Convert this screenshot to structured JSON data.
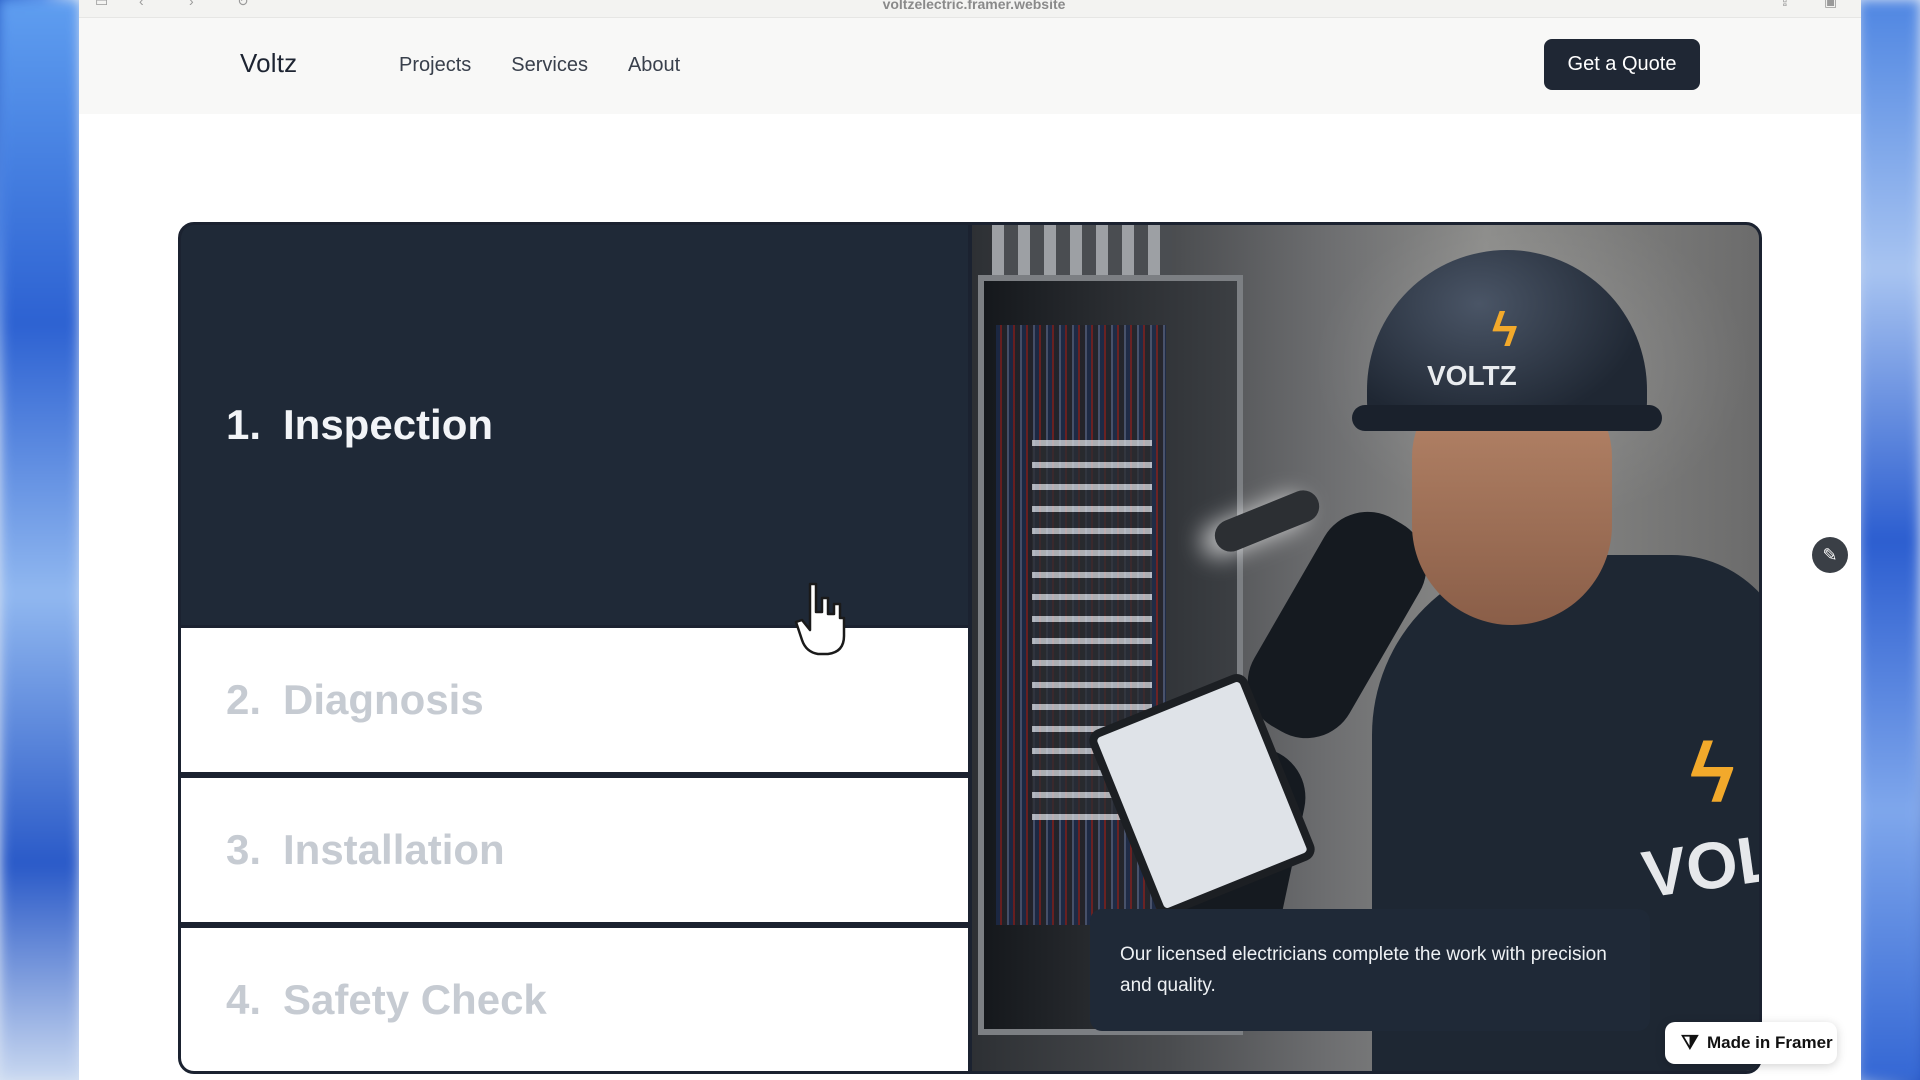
{
  "browser": {
    "url": "voltzelectric.framer.website"
  },
  "header": {
    "logo": "Voltz",
    "nav": [
      "Projects",
      "Services",
      "About"
    ],
    "cta_label": "Get a Quote"
  },
  "steps": [
    {
      "number": "1.",
      "label": "Inspection",
      "active": true
    },
    {
      "number": "2.",
      "label": "Diagnosis",
      "active": false
    },
    {
      "number": "3.",
      "label": "Installation",
      "active": false
    },
    {
      "number": "4.",
      "label": "Safety Check",
      "active": false
    }
  ],
  "photo": {
    "helmet_text": "VOLTZ",
    "shirt_text": "VOLT",
    "caption": "Our licensed electricians complete the work with precision and quality."
  },
  "badge": {
    "label": "Made in Framer"
  },
  "colors": {
    "dark": "#1f2937",
    "inactive_text": "#c6cbd2",
    "accent_bolt": "#f2a92b"
  }
}
